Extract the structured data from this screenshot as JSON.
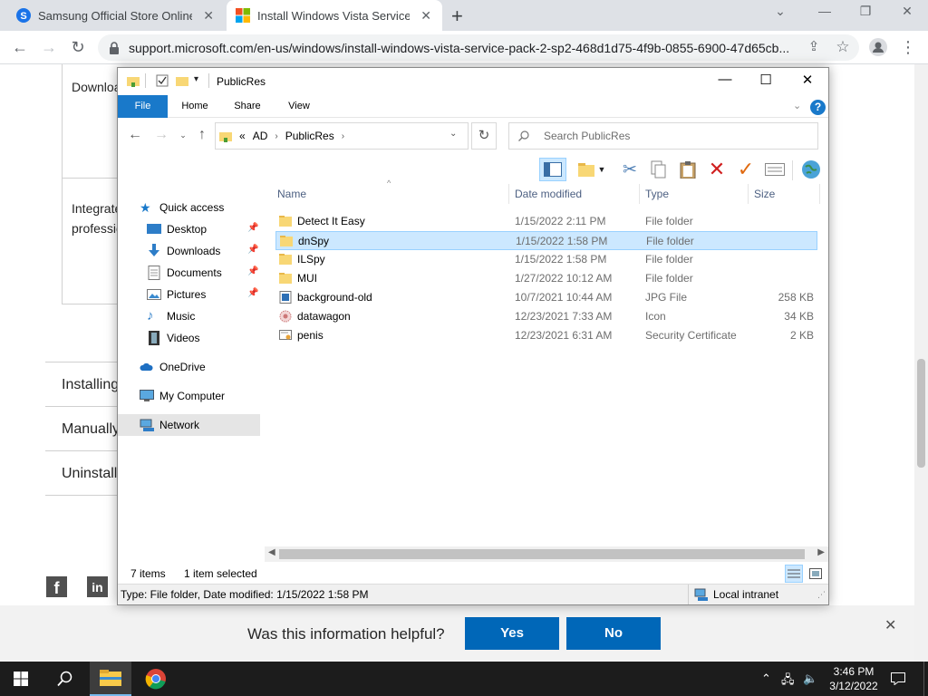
{
  "browser": {
    "tabs": [
      {
        "title": "Samsung Official Store Online Pr",
        "active": false
      },
      {
        "title": "Install Windows Vista Service Pac",
        "active": true
      }
    ],
    "new_tab": "+",
    "url": "support.microsoft.com/en-us/windows/install-windows-vista-service-pack-2-sp2-468d1d75-4f9b-0855-6900-47d65cb...",
    "window_buttons": {
      "minimize": "—",
      "restore": "❐",
      "close": "✕"
    }
  },
  "webpage": {
    "fragments": [
      "Downloa",
      "Integrate",
      "professio",
      "Installing",
      "Manually",
      "Uninstall"
    ],
    "feedback": {
      "question": "Was this information helpful?",
      "yes": "Yes",
      "no": "No",
      "close": "✕"
    },
    "social": {
      "facebook": "f",
      "linkedin": "in"
    }
  },
  "explorer": {
    "title": "PublicRes",
    "ribbon_tabs": [
      "File",
      "Home",
      "Share",
      "View"
    ],
    "help": "?",
    "breadcrumb": [
      "AD",
      "PublicRes"
    ],
    "breadcrumb_prefix": "«",
    "search_placeholder": "Search PublicRes",
    "nav": {
      "quick_access": "Quick access",
      "items": [
        "Desktop",
        "Downloads",
        "Documents",
        "Pictures",
        "Music",
        "Videos"
      ],
      "onedrive": "OneDrive",
      "my_computer": "My Computer",
      "network": "Network"
    },
    "columns": [
      "Name",
      "Date modified",
      "Type",
      "Size"
    ],
    "files": [
      {
        "name": "Detect It Easy",
        "date": "1/15/2022 2:11 PM",
        "type": "File folder",
        "size": "",
        "icon": "folder-icon"
      },
      {
        "name": "dnSpy",
        "date": "1/15/2022 1:58 PM",
        "type": "File folder",
        "size": "",
        "icon": "folder-icon",
        "selected": true
      },
      {
        "name": "ILSpy",
        "date": "1/15/2022 1:58 PM",
        "type": "File folder",
        "size": "",
        "icon": "folder-icon"
      },
      {
        "name": "MUI",
        "date": "1/27/2022 10:12 AM",
        "type": "File folder",
        "size": "",
        "icon": "folder-icon"
      },
      {
        "name": "background-old",
        "date": "10/7/2021 10:44 AM",
        "type": "JPG File",
        "size": "258 KB",
        "icon": "image-file-icon"
      },
      {
        "name": "datawagon",
        "date": "12/23/2021 7:33 AM",
        "type": "Icon",
        "size": "34 KB",
        "icon": "icon-file-icon"
      },
      {
        "name": "penis",
        "date": "12/23/2021 6:31 AM",
        "type": "Security Certificate",
        "size": "2 KB",
        "icon": "certificate-icon"
      }
    ],
    "status": {
      "count": "7 items",
      "selection": "1 item selected"
    },
    "details": {
      "text": "Type: File folder, Date modified: 1/15/2022 1:58 PM",
      "zone": "Local intranet"
    }
  },
  "taskbar": {
    "time": "3:46 PM",
    "date": "3/12/2022"
  },
  "colors": {
    "accent": "#1979ca",
    "ms_blue": "#0067b8",
    "selection": "#cce8ff"
  }
}
